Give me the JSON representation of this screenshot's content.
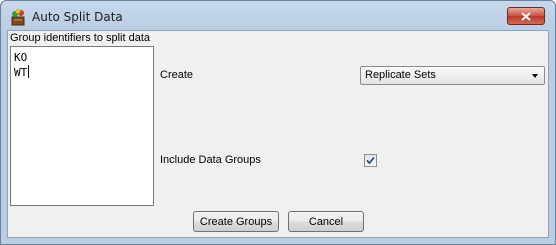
{
  "window": {
    "title": "Auto Split Data",
    "icon": "app-icon"
  },
  "groups": {
    "label": "Group identifiers to split data",
    "lines": [
      "KO",
      "WT"
    ]
  },
  "create": {
    "label": "Create",
    "selected": "Replicate Sets"
  },
  "include": {
    "label": "Include Data Groups",
    "checked": true
  },
  "buttons": {
    "create_groups": "Create Groups",
    "cancel": "Cancel"
  },
  "colors": {
    "titlebar": "#c6d8ec",
    "close_button": "#c9503c",
    "client_bg": "#f0f0f0"
  }
}
